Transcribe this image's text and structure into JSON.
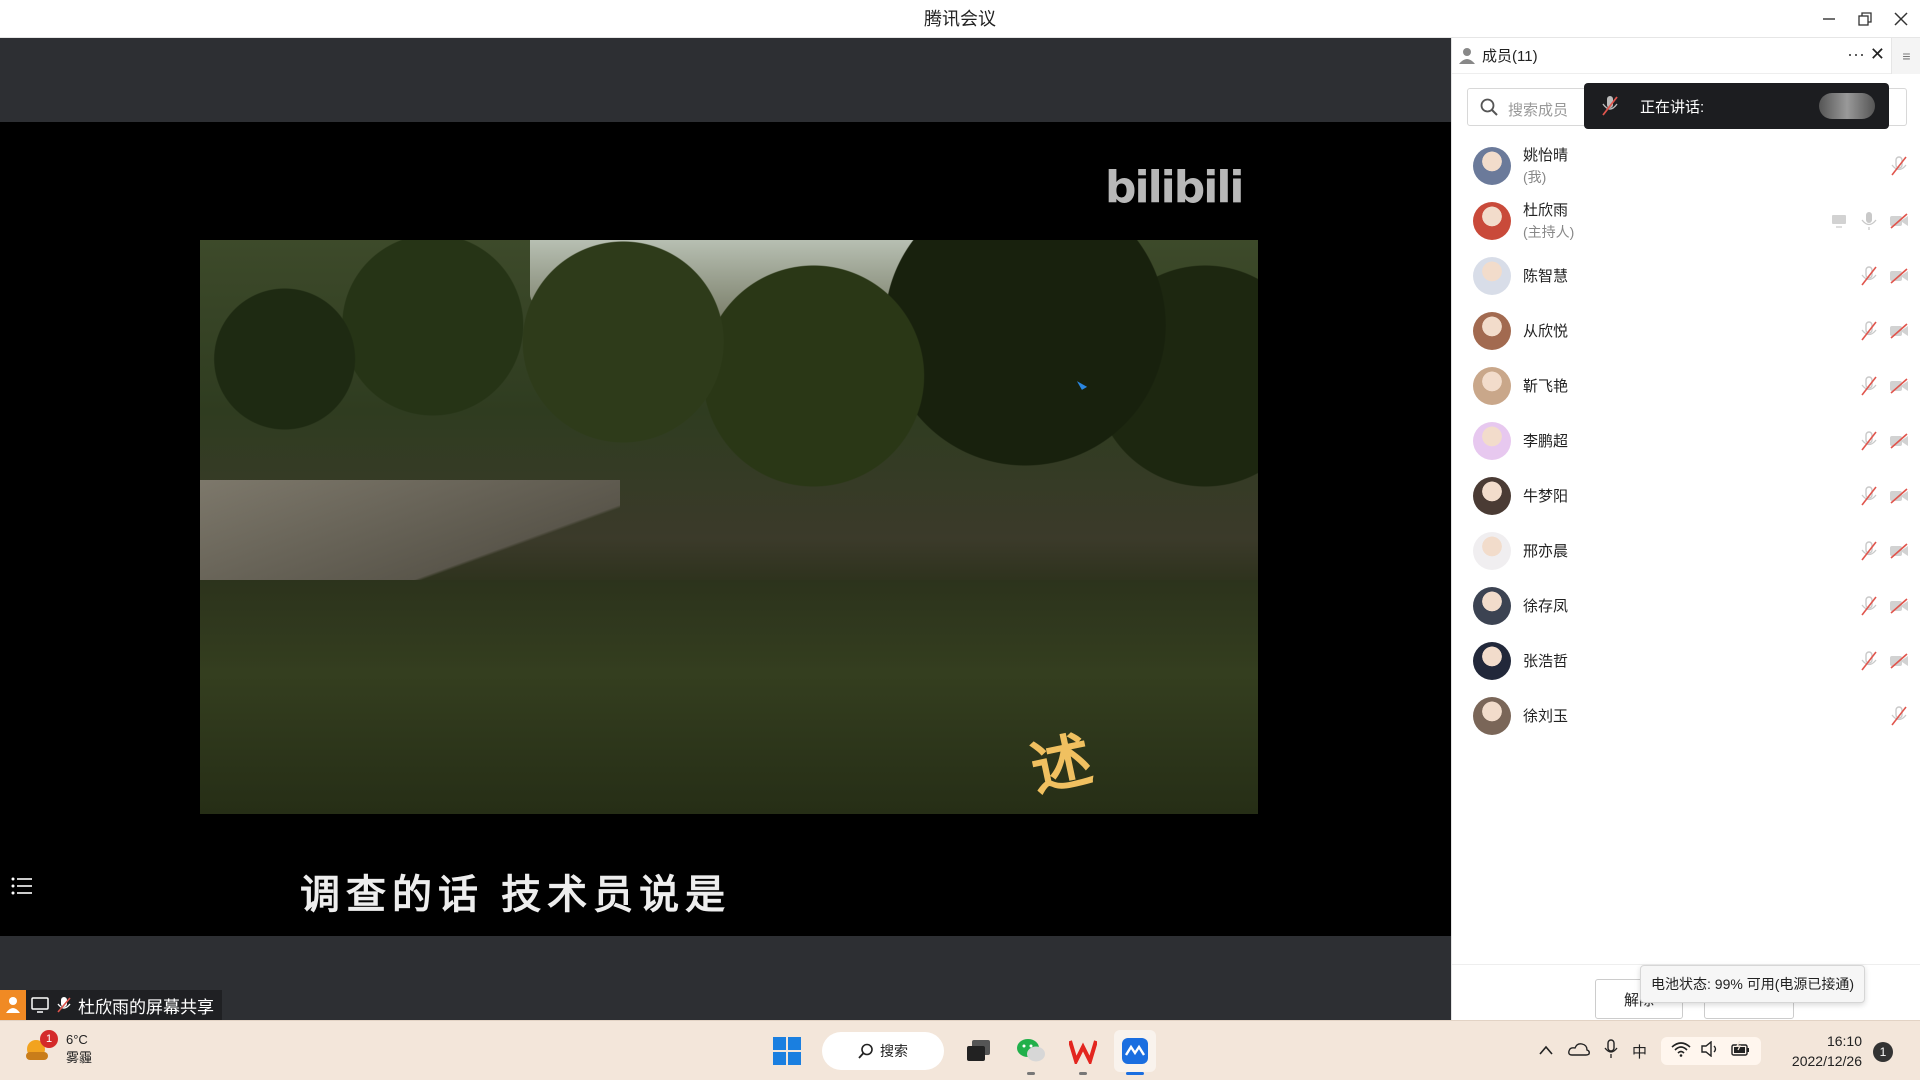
{
  "window": {
    "title": "腾讯会议"
  },
  "video": {
    "watermark": "bilibili",
    "subtitle": "调查的话  技术员说是"
  },
  "share_bar": {
    "label": "杜欣雨的屏幕共享"
  },
  "panel": {
    "title": "成员(11)",
    "search_placeholder": "搜索成员",
    "speaking_label": "正在讲话:",
    "members": [
      {
        "name": "姚怡晴",
        "role": "(我)",
        "avatar_color": "#6b7a9a",
        "mic": "muted",
        "cam": "none",
        "share": false
      },
      {
        "name": "杜欣雨",
        "role": "(主持人)",
        "avatar_color": "#c94a3a",
        "mic": "on",
        "cam": "off",
        "share": true
      },
      {
        "name": "陈智慧",
        "role": "",
        "avatar_color": "#d8dde8",
        "mic": "muted",
        "cam": "off",
        "share": false
      },
      {
        "name": "从欣悦",
        "role": "",
        "avatar_color": "#a26a50",
        "mic": "muted",
        "cam": "off",
        "share": false
      },
      {
        "name": "靳飞艳",
        "role": "",
        "avatar_color": "#c9a78a",
        "mic": "muted",
        "cam": "off",
        "share": false
      },
      {
        "name": "李鹏超",
        "role": "",
        "avatar_color": "#e7c8ef",
        "mic": "muted",
        "cam": "off",
        "share": false
      },
      {
        "name": "牛梦阳",
        "role": "",
        "avatar_color": "#4a3b34",
        "mic": "muted",
        "cam": "off",
        "share": false
      },
      {
        "name": "邢亦晨",
        "role": "",
        "avatar_color": "#f0eef0",
        "mic": "muted",
        "cam": "off",
        "share": false
      },
      {
        "name": "徐存凤",
        "role": "",
        "avatar_color": "#3c4352",
        "mic": "muted",
        "cam": "off",
        "share": false
      },
      {
        "name": "张浩哲",
        "role": "",
        "avatar_color": "#22283a",
        "mic": "muted",
        "cam": "off",
        "share": false
      },
      {
        "name": "徐刘玉",
        "role": "",
        "avatar_color": "#7a6658",
        "mic": "muted",
        "cam": "none",
        "share": false
      }
    ],
    "footer": {
      "unmute_label": "解除",
      "battery_tooltip": "电池状态: 99% 可用(电源已接通)"
    }
  },
  "taskbar": {
    "weather_temp": "6°C",
    "weather_desc": "雾霾",
    "weather_badge": "1",
    "search_label": "搜索",
    "ime": "中",
    "time": "16:10",
    "date": "2022/12/26",
    "notification_count": "1"
  },
  "colors": {
    "accent": "#1a6ee0",
    "muted_red": "#e0554d"
  }
}
